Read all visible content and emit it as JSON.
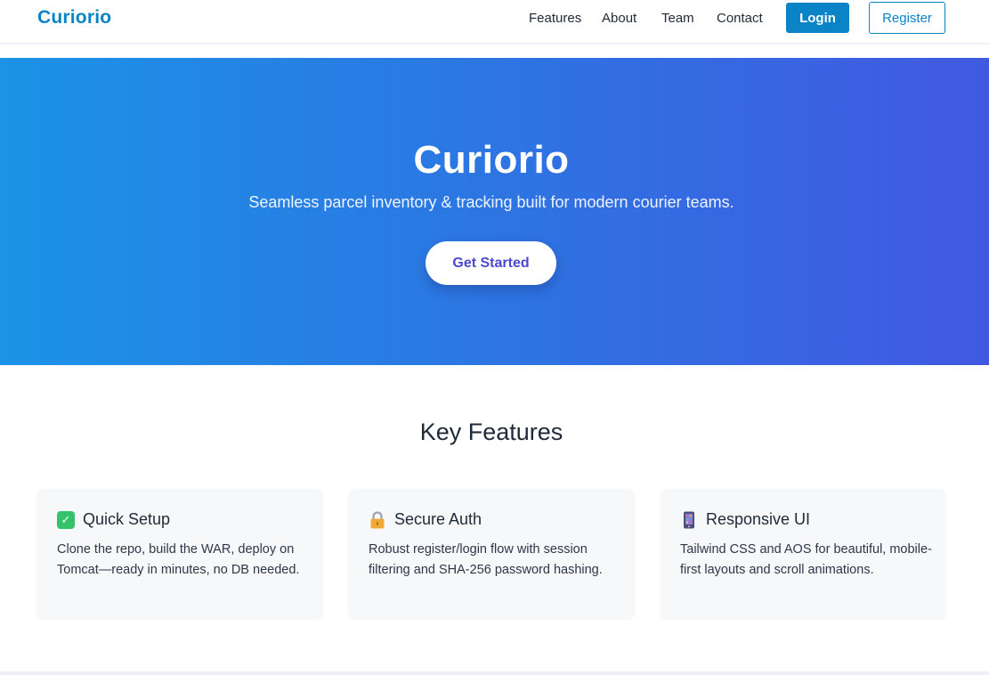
{
  "header": {
    "brand": "Curiorio",
    "nav": [
      {
        "label": "Features"
      },
      {
        "label": "About"
      },
      {
        "label": "Team"
      },
      {
        "label": "Contact"
      }
    ],
    "login_label": "Login",
    "register_label": "Register"
  },
  "hero": {
    "title": "Curiorio",
    "subtitle": "Seamless parcel inventory & tracking built for modern courier teams.",
    "cta_label": "Get Started"
  },
  "features": {
    "heading": "Key Features",
    "cards": [
      {
        "icon": "check-mark-icon",
        "icon_glyph": "✓",
        "title": "Quick Setup",
        "description": "Clone the repo, build the WAR, deploy on Tomcat—ready in minutes, no DB needed."
      },
      {
        "icon": "lock-icon",
        "title": "Secure Auth",
        "description": "Robust register/login flow with session filtering and SHA-256 password hashing."
      },
      {
        "icon": "mobile-phone-icon",
        "title": "Responsive UI",
        "description": "Tailwind CSS and AOS for beautiful, mobile-first layouts and scroll animations."
      }
    ]
  },
  "colors": {
    "brand": "#0a84c6",
    "hero_gradient_start": "#1b93e6",
    "hero_gradient_end": "#4159e1",
    "cta_text": "#4a49cf",
    "check_green": "#34c36b"
  }
}
